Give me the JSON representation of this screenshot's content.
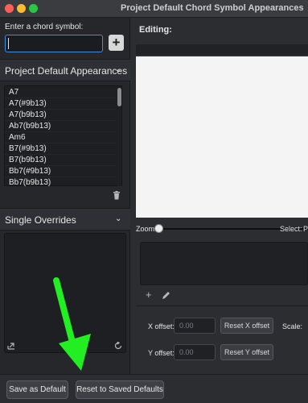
{
  "window": {
    "title": "Project Default Chord Symbol Appearances"
  },
  "colors": {
    "accent": "#3b8de0",
    "arrow": "#22ee22",
    "close": "#ff5f57",
    "minimize": "#febc2e",
    "zoom": "#28c840"
  },
  "chord_entry": {
    "label": "Enter a chord symbol:",
    "value": "",
    "add_label": "+"
  },
  "project_defaults": {
    "title": "Project Default Appearances",
    "items": [
      "A7",
      "A7(#9b13)",
      "A7(b9b13)",
      "Ab7(b9b13)",
      "Am6",
      "B7(#9b13)",
      "B7(b9b13)",
      "Bb7(#9b13)",
      "Bb7(b9b13)"
    ]
  },
  "single_overrides": {
    "title": "Single Overrides"
  },
  "editor": {
    "title": "Editing:",
    "zoom_label": "Zoom:",
    "zoom_level": 0,
    "select_label": "Select:",
    "select_value": "P",
    "x_offset_label": "X offset:",
    "x_offset_value": "0.00",
    "reset_x": "Reset X offset",
    "y_offset_label": "Y offset:",
    "y_offset_value": "0.00",
    "reset_y": "Reset Y offset",
    "scale_label": "Scale:"
  },
  "footer": {
    "save_default": "Save as Default",
    "reset_defaults": "Reset to Saved Defaults"
  }
}
